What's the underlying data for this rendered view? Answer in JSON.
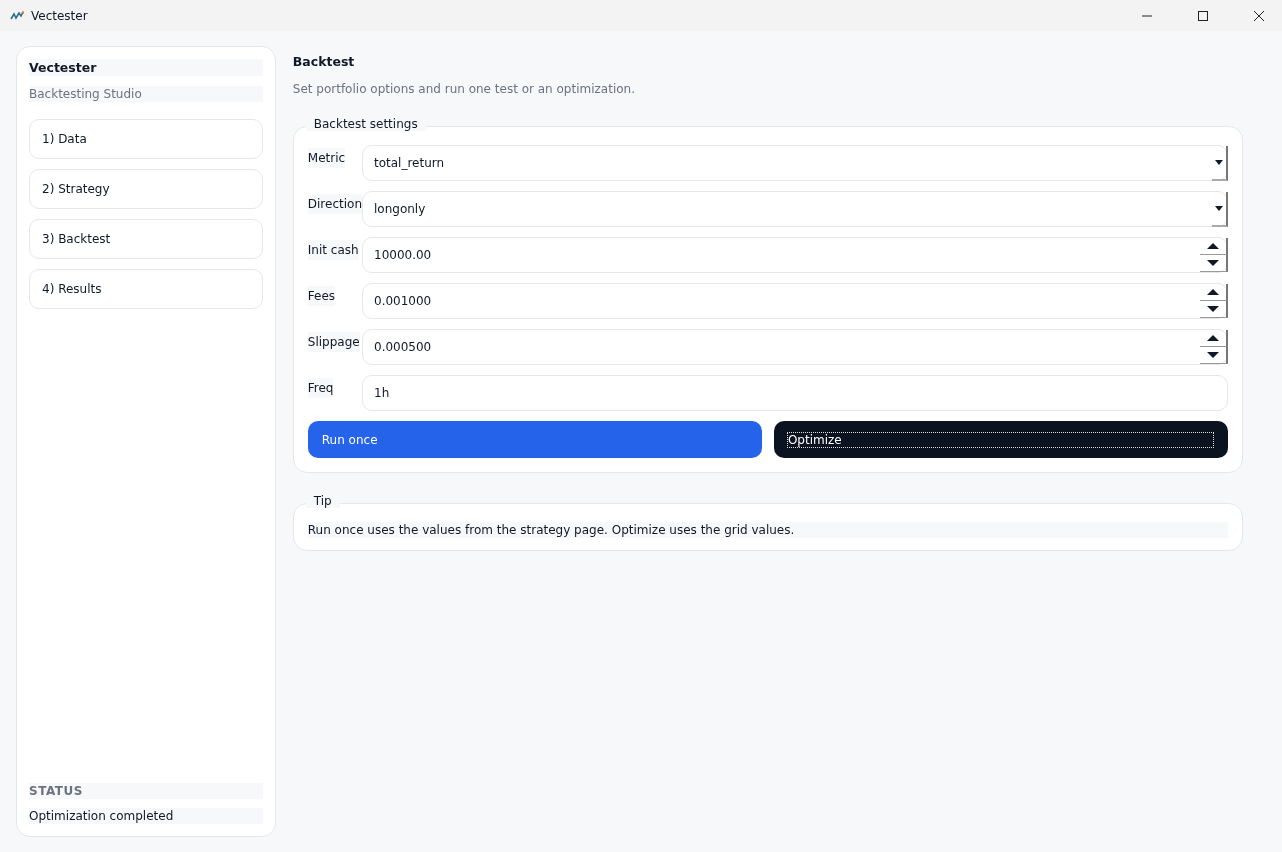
{
  "window": {
    "title": "Vectester"
  },
  "sidebar": {
    "title": "Vectester",
    "subtitle": "Backtesting Studio",
    "items": [
      {
        "label": "1) Data"
      },
      {
        "label": "2) Strategy"
      },
      {
        "label": "3) Backtest"
      },
      {
        "label": "4) Results"
      }
    ],
    "status_heading": "STATUS",
    "status": "Optimization completed"
  },
  "page": {
    "title": "Backtest",
    "description": "Set portfolio options and run one test or an optimization."
  },
  "settings": {
    "legend": "Backtest settings",
    "fields": [
      {
        "label": "Metric",
        "kind": "dropdown",
        "value": "total_return"
      },
      {
        "label": "Direction",
        "kind": "dropdown",
        "value": "longonly"
      },
      {
        "label": "Init cash",
        "kind": "spin",
        "value": "10000.00"
      },
      {
        "label": "Fees",
        "kind": "spin",
        "value": "0.001000"
      },
      {
        "label": "Slippage",
        "kind": "spin",
        "value": "0.000500"
      },
      {
        "label": "Freq",
        "kind": "text",
        "value": "1h"
      }
    ],
    "buttons": [
      {
        "label": "Run once",
        "kind": "primary",
        "focused": false
      },
      {
        "label": "Optimize",
        "kind": "dark",
        "focused": true
      }
    ]
  },
  "tip": {
    "legend": "Tip",
    "text": "Run once uses the values from the strategy page. Optimize uses the grid values."
  }
}
